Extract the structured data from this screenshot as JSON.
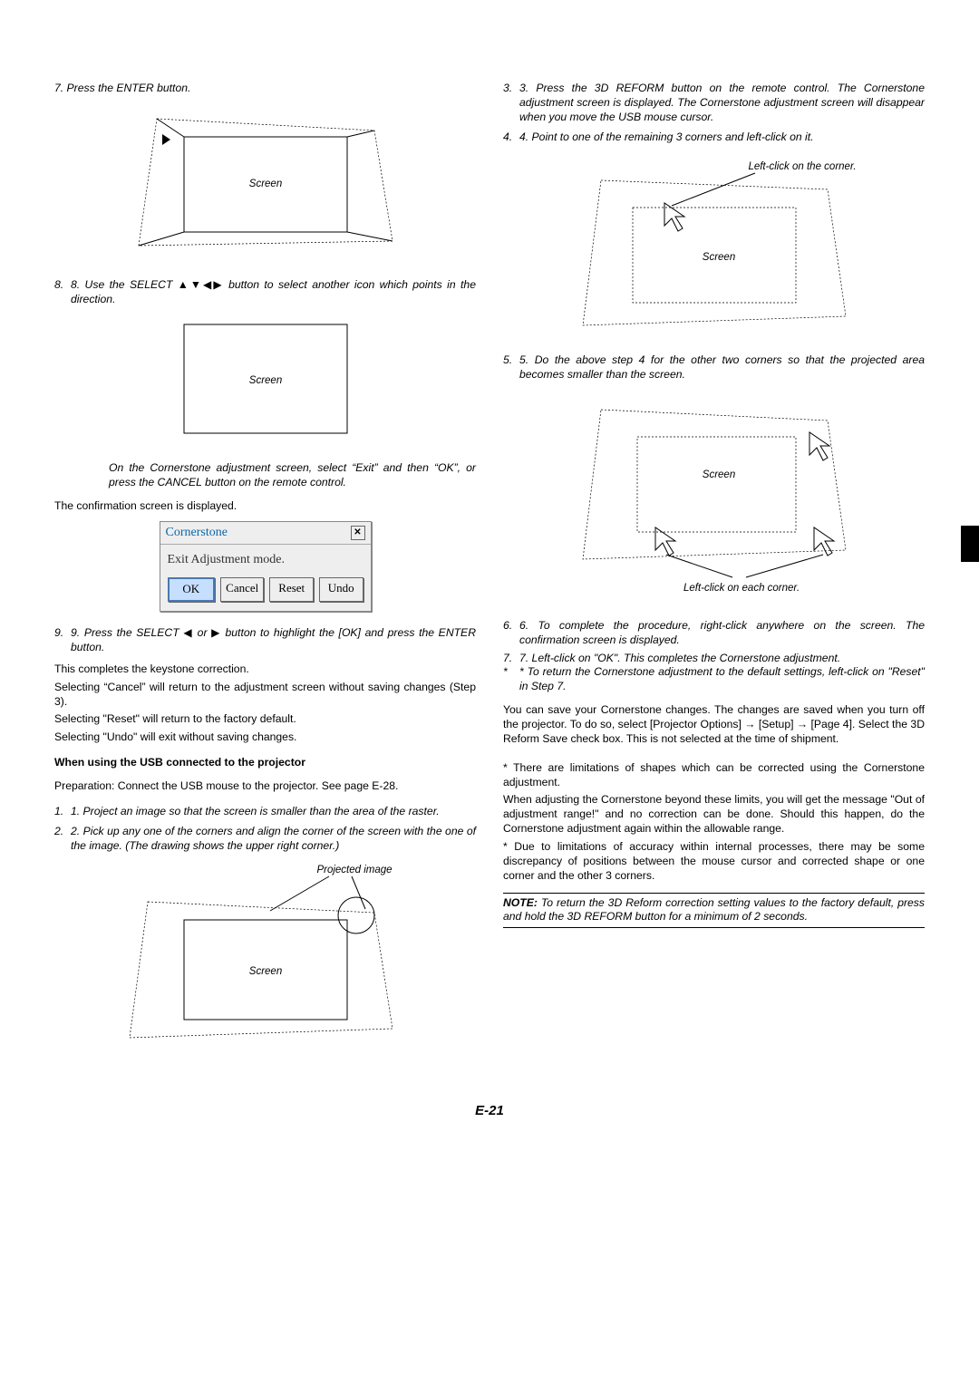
{
  "left": {
    "step7": "7.  Press the ENTER button.",
    "fig1_screen": "Screen",
    "step8_pre": "8.  Use the SELECT ",
    "step8_post": " button to select another icon which points in the direction.",
    "fig2_screen": "Screen",
    "fig2_note": "On the Cornerstone adjustment screen, select “Exit” and then “OK”, or press the CANCEL button on the remote control.",
    "confirm": "The confirmation screen is displayed.",
    "dialog": {
      "title": "Cornerstone",
      "body": "Exit Adjustment mode.",
      "ok": "OK",
      "cancel": "Cancel",
      "reset": "Reset",
      "undo": "Undo"
    },
    "step9_pre": "9.  Press the SELECT ",
    "step9_mid": " or ",
    "step9_post": " button to highlight the [OK] and press the ENTER button.",
    "t1": "This completes the keystone correction.",
    "t2": "Selecting “Cancel” will return to the adjustment screen without saving changes (Step 3).",
    "t3": "Selecting \"Reset\" will return to the factory default.",
    "t4": "Selecting \"Undo\" will exit without saving changes.",
    "usb_head": "When using the USB connected to the projector",
    "usb_prep": "Preparation: Connect the USB mouse to the projector. See page E-28.",
    "usb1": "1.  Project an image so that the screen is smaller than the area of the raster.",
    "usb2": "2.  Pick up any one of the corners and align the corner of the screen with the one of the image. (The drawing shows the upper right corner.)",
    "fig3_proj": "Projected image",
    "fig3_screen": "Screen"
  },
  "right": {
    "step3": "3.  Press the 3D REFORM button on the remote control. The Cornerstone adjustment screen is displayed. The Cornerstone adjustment screen will disappear when you move the USB mouse cursor.",
    "step4": "4.  Point to one of the remaining 3 corners and left-click on it.",
    "fig4_label": "Left-click on the corner.",
    "fig4_screen": "Screen",
    "step5": "5.  Do the above step 4 for the other two corners so that the projected area becomes smaller than the screen.",
    "fig5_screen": "Screen",
    "fig5_label": "Left-click on each corner.",
    "step6": "6.  To complete the procedure, right-click anywhere on the screen. The confirmation screen is displayed.",
    "step7": "7.  Left-click on \"OK\". This completes the Cornerstone adjustment.",
    "star": "*  To return the Cornerstone adjustment to the default settings, left-click on \"Reset\" in Step 7.",
    "save": "You can save your Cornerstone changes. The changes are saved when you turn off the projector. To do so, select [Projector Options] → [Setup] → [Page 4]. Select the 3D Reform Save check box. This is not selected at the time of shipment.",
    "lim1": "* There are limitations of shapes which can be corrected using the Cornerstone adjustment.",
    "lim2": "When adjusting the Cornerstone beyond these limits, you will get the message \"Out of adjustment range!\" and no correction can be done. Should this happen, do the Cornerstone adjustment again within the allowable range.",
    "lim3": "* Due to limitations of accuracy within internal processes, there may be some discrepancy of positions between the mouse cursor and corrected shape or one corner and the other 3 corners.",
    "note_label": "NOTE:",
    "note": " To return the 3D Reform correction setting values to the factory default, press and hold the 3D REFORM button for a minimum of 2 seconds."
  },
  "pagenum": "E-21"
}
